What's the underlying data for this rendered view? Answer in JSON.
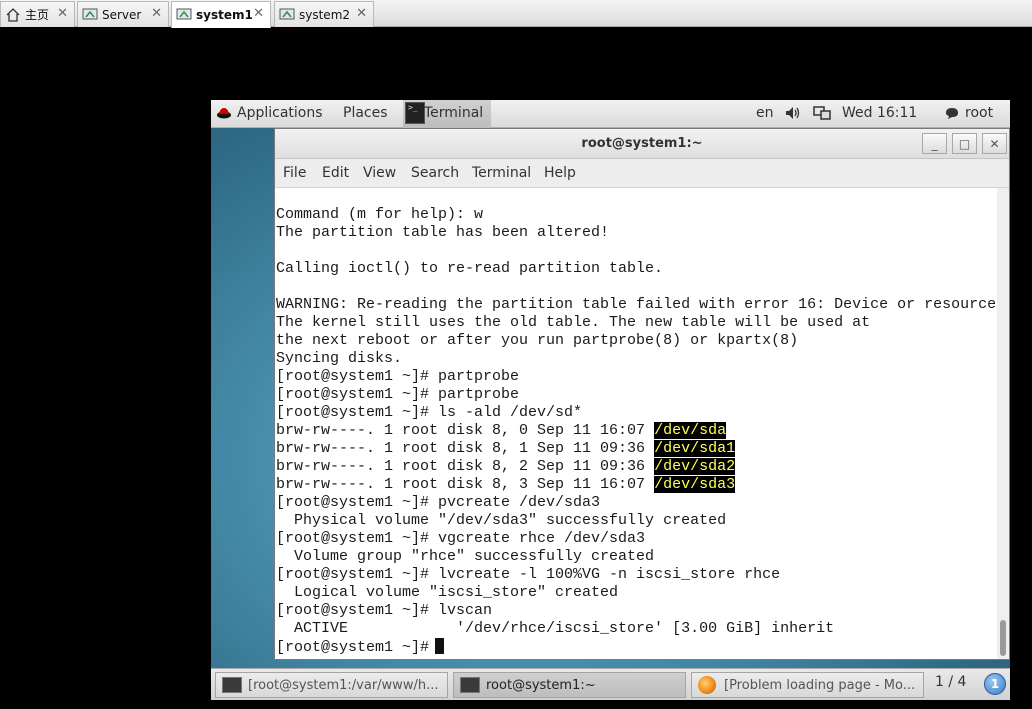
{
  "host_tabs": [
    {
      "label": "主页"
    },
    {
      "label": "Server"
    },
    {
      "label": "system1"
    },
    {
      "label": "system2"
    }
  ],
  "topbar": {
    "applications": "Applications",
    "places": "Places",
    "terminal": "Terminal",
    "lang": "en",
    "clock": "Wed 16:11",
    "user": "root"
  },
  "window": {
    "title": "root@system1:~",
    "minimize": "_",
    "maximize": "□",
    "close": "✕"
  },
  "menu": [
    "File",
    "Edit",
    "View",
    "Search",
    "Terminal",
    "Help"
  ],
  "console": {
    "lines": [
      "Command (m for help): w",
      "The partition table has been altered!",
      "",
      "Calling ioctl() to re-read partition table.",
      "",
      "WARNING: Re-reading the partition table failed with error 16: Device or resource",
      "The kernel still uses the old table. The new table will be used at",
      "the next reboot or after you run partprobe(8) or kpartx(8)",
      "Syncing disks.",
      "[root@system1 ~]# partprobe",
      "[root@system1 ~]# partprobe",
      "[root@system1 ~]# ls -ald /dev/sd*"
    ],
    "ls_rows": [
      {
        "prefix": "brw-rw----. 1 root disk 8, 0 Sep 11 16:07 ",
        "dev": "/dev/sda"
      },
      {
        "prefix": "brw-rw----. 1 root disk 8, 1 Sep 11 09:36 ",
        "dev": "/dev/sda1"
      },
      {
        "prefix": "brw-rw----. 1 root disk 8, 2 Sep 11 09:36 ",
        "dev": "/dev/sda2"
      },
      {
        "prefix": "brw-rw----. 1 root disk 8, 3 Sep 11 16:07 ",
        "dev": "/dev/sda3"
      }
    ],
    "tail": [
      "[root@system1 ~]# pvcreate /dev/sda3",
      "  Physical volume \"/dev/sda3\" successfully created",
      "[root@system1 ~]# vgcreate rhce /dev/sda3",
      "  Volume group \"rhce\" successfully created",
      "[root@system1 ~]# lvcreate -l 100%VG -n iscsi_store rhce",
      "  Logical volume \"iscsi_store\" created",
      "[root@system1 ~]# lvscan",
      "  ACTIVE            '/dev/rhce/iscsi_store' [3.00 GiB] inherit"
    ],
    "prompt": "[root@system1 ~]#"
  },
  "taskbar": {
    "items": [
      {
        "label": "[root@system1:/var/www/h..."
      },
      {
        "label": "root@system1:~"
      },
      {
        "label": "[Problem loading page - Mo..."
      }
    ],
    "pager": "1 / 4",
    "badge": "1"
  }
}
